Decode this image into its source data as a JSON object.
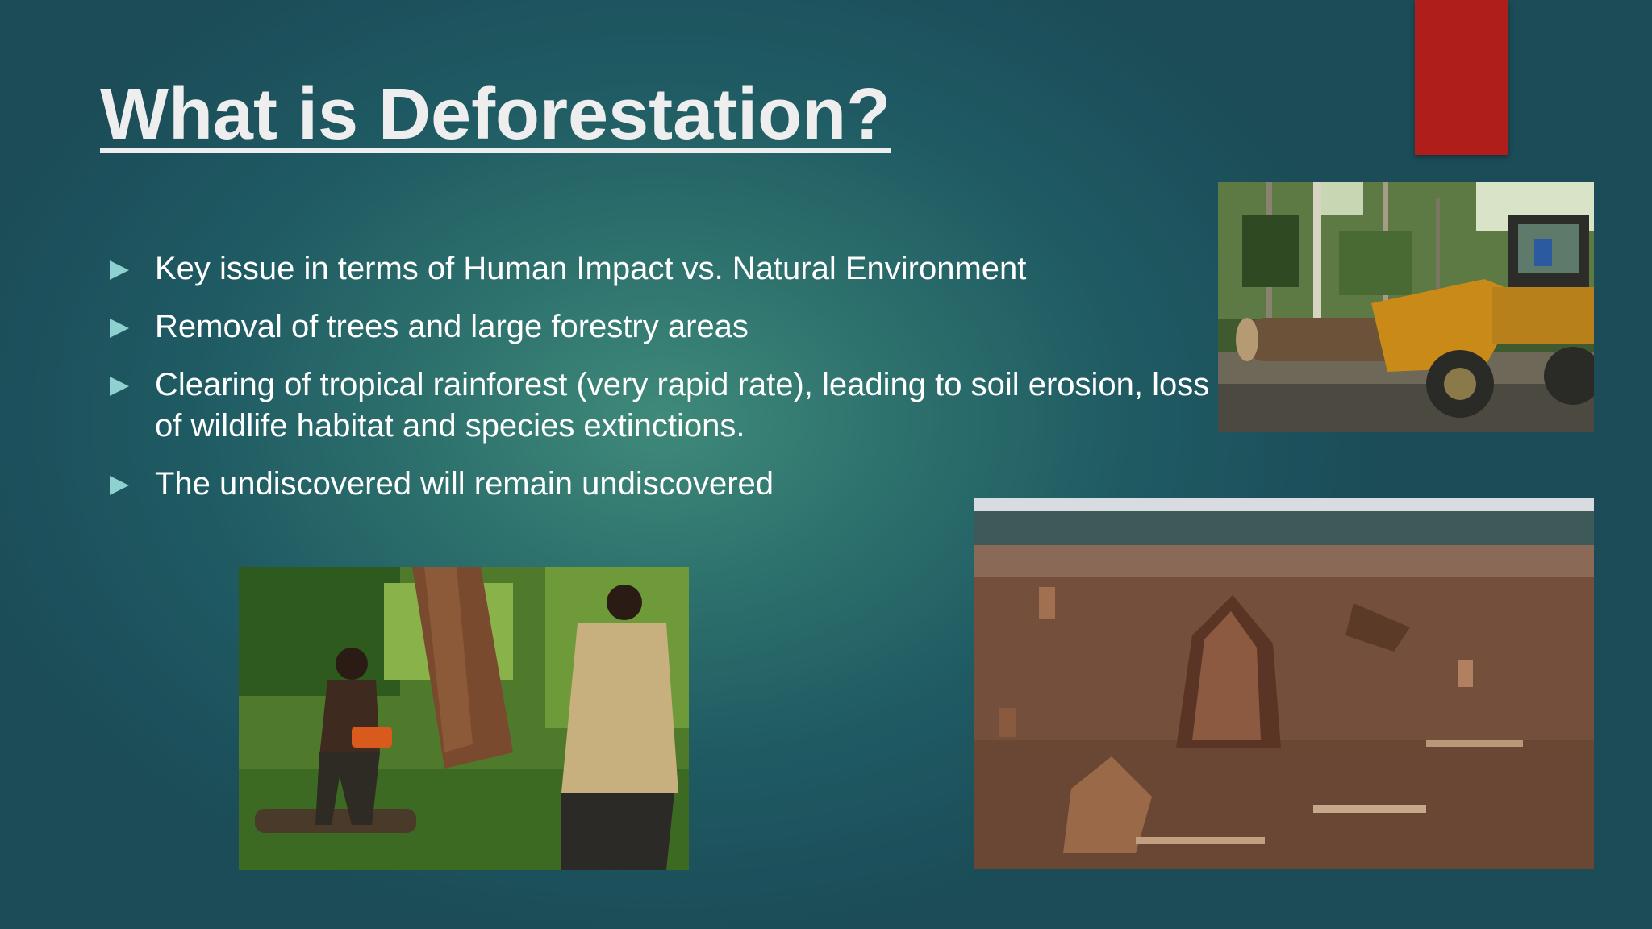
{
  "slide": {
    "title": "What is Deforestation?",
    "accent_color": "#b01e1c",
    "bullets": [
      "Key issue in terms of Human Impact vs. Natural Environment",
      "Removal of trees and large forestry areas",
      "Clearing of tropical rainforest (very rapid rate), leading to soil erosion, loss of wildlife habitat and species extinctions.",
      "The undiscovered will remain undiscovered"
    ],
    "images": [
      {
        "subject": "log-loader-in-forest"
      },
      {
        "subject": "men-cutting-tree-with-chainsaw"
      },
      {
        "subject": "cleared-rainforest-stumps"
      }
    ]
  }
}
